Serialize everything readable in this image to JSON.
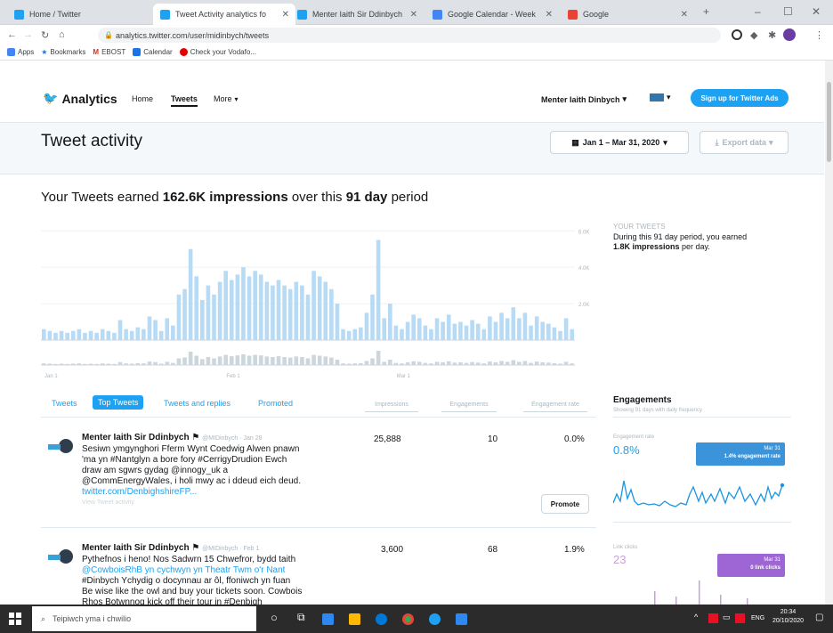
{
  "browser": {
    "tabs": [
      {
        "title": "Home / Twitter",
        "color": "#1da1f2"
      },
      {
        "title": "Tweet Activity analytics fo",
        "color": "#1da1f2"
      },
      {
        "title": "Menter Iaith Sir Ddinbych",
        "color": "#1da1f2"
      },
      {
        "title": "Google Calendar - Week",
        "color": "#4285f4"
      },
      {
        "title": "Google",
        "color": "#ea4335"
      }
    ],
    "url": "analytics.twitter.com/user/midinbych/tweets",
    "bookmarks": [
      "Apps",
      "Bookmarks",
      "EBOST",
      "Calendar",
      "Check your Vodafo..."
    ]
  },
  "nav": {
    "brand": "Analytics",
    "items": [
      "Home",
      "Tweets",
      "More"
    ],
    "account": "Menter Iaith Dinbych",
    "signup": "Sign up for Twitter Ads"
  },
  "header": {
    "title": "Tweet activity",
    "date_range": "Jan 1 – Mar 31, 2020",
    "export": "Export data"
  },
  "summary": {
    "prefix": "Your Tweets earned ",
    "impressions": "162.6K impressions",
    "middle": " over this ",
    "days": "91 day",
    "suffix": " period"
  },
  "chart_data": {
    "type": "bar",
    "ylabels": [
      "6.0K",
      "4.0K",
      "2.0K"
    ],
    "xlabels": [
      "Jan 1",
      "Feb 1",
      "Mar 1"
    ],
    "values": [
      0.6,
      0.5,
      0.4,
      0.5,
      0.4,
      0.5,
      0.6,
      0.4,
      0.5,
      0.4,
      0.6,
      0.5,
      0.4,
      1.1,
      0.6,
      0.5,
      0.7,
      0.6,
      1.3,
      1.1,
      0.5,
      1.2,
      0.8,
      2.5,
      2.8,
      5.0,
      3.5,
      2.2,
      3.0,
      2.5,
      3.2,
      3.8,
      3.3,
      3.6,
      4.0,
      3.5,
      3.8,
      3.6,
      3.2,
      3.0,
      3.3,
      3.0,
      2.8,
      3.2,
      3.0,
      2.5,
      3.8,
      3.5,
      3.2,
      2.8,
      2.0,
      0.6,
      0.5,
      0.6,
      0.7,
      1.5,
      2.5,
      5.5,
      1.2,
      2.0,
      0.8,
      0.6,
      1.0,
      1.4,
      1.2,
      0.8,
      0.6,
      1.2,
      1.0,
      1.4,
      0.9,
      1.0,
      0.8,
      1.1,
      0.9,
      0.6,
      1.3,
      1.0,
      1.5,
      1.2,
      1.8,
      1.2,
      1.5,
      0.8,
      1.3,
      1.0,
      0.9,
      0.7,
      0.5,
      1.2,
      0.6
    ],
    "ymax": 6.6
  },
  "your_tweets": {
    "title": "YOUR TWEETS",
    "line1": "During this 91 day period, you earned",
    "bold": "1.8K impressions",
    "line2": " per day."
  },
  "table": {
    "tabs": [
      "Tweets",
      "Top Tweets",
      "Tweets and replies",
      "Promoted"
    ],
    "columns": [
      "Impressions",
      "Engagements",
      "Engagement rate"
    ],
    "rows": [
      {
        "author": "Menter Iaith Sir Ddinbych",
        "handle": "@MIDinbych · Jan 28",
        "lines": [
          "Sesiwn ymgynghori Fferm Wynt Coedwig Alwen pnawn",
          "'ma yn #Nantglyn a bore fory #CerrigyDrudion Ewch",
          "draw am sgwrs gydag @innogy_uk a",
          "@CommEnergyWales, i holi mwy ac i ddeud eich deud.",
          "twitter.com/DenbighshireFP..."
        ],
        "view": "View Tweet activity",
        "impressions": "25,888",
        "engagements": "10",
        "rate": "0.0%",
        "promote": "Promote"
      },
      {
        "author": "Menter Iaith Sir Ddinbych",
        "handle": "@MIDinbych · Feb 1",
        "lines": [
          "Pythefnos i heno! Nos Sadwrn 15 Chwefror, bydd taith",
          "@CowboisRhB yn cychwyn yn Theatr Twm o'r Nant",
          "#Dinbych Ychydig o docynnau ar ôl, ffoniwch yn fuan",
          "Be wise like the owl and buy your tickets soon. Cowbois",
          "Rhos Botwnnog kick off their tour in #Denbigh"
        ],
        "impressions": "3,600",
        "engagements": "68",
        "rate": "1.9%"
      }
    ]
  },
  "engagements": {
    "title": "Engagements",
    "sub": "Showing 91 days with daily frequency",
    "rate_label": "Engagement rate",
    "rate_value": "0.8%",
    "rate_tag_date": "Mar 31",
    "rate_tag": "1.4% engagement rate",
    "clicks_label": "Link clicks",
    "clicks_value": "23",
    "clicks_tag_date": "Mar 31",
    "clicks_tag": "0 link clicks"
  },
  "taskbar": {
    "search": "Teipiwch yma i chwilio",
    "time": "20:34",
    "date": "20/10/2020",
    "lang": "ENG"
  }
}
